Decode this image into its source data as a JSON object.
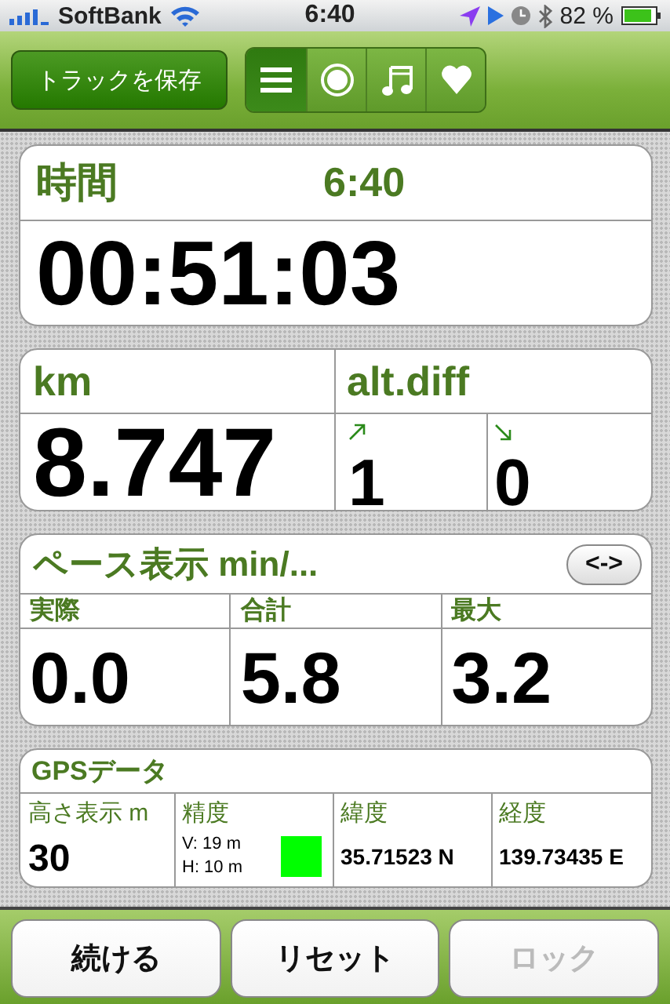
{
  "status_bar": {
    "carrier": "SoftBank",
    "time": "6:40",
    "battery": "82 %"
  },
  "toolbar": {
    "save_button": "トラックを保存",
    "segments": [
      {
        "kind": "list",
        "selected": true
      },
      {
        "kind": "record",
        "selected": false
      },
      {
        "kind": "music",
        "selected": false
      },
      {
        "kind": "heart",
        "selected": false
      }
    ]
  },
  "time_card": {
    "label": "時間",
    "clock": "6:40",
    "value": "00:51:03"
  },
  "distance_card": {
    "label": "km",
    "value": "8.747",
    "alt_label": "alt.diff",
    "ascent": "1",
    "descent": "0"
  },
  "pace_card": {
    "title": "ペース表示 min/...",
    "toggle": "<->",
    "cells": [
      {
        "label": "実際",
        "value": "0.0"
      },
      {
        "label": "合計",
        "value": "5.8"
      },
      {
        "label": "最大",
        "value": "3.2"
      }
    ]
  },
  "gps_card": {
    "title": "GPSデータ",
    "altitude": {
      "label": "高さ表示 m",
      "value": "30"
    },
    "accuracy": {
      "label": "精度",
      "vertical": "V: 19 m",
      "horizontal": "H: 10 m",
      "color": "#00ff00"
    },
    "latitude": {
      "label": "緯度",
      "value": "35.71523 N"
    },
    "longitude": {
      "label": "経度",
      "value": "139.73435 E"
    }
  },
  "buttons": [
    {
      "label": "続ける",
      "disabled": false
    },
    {
      "label": "リセット",
      "disabled": false
    },
    {
      "label": "ロック",
      "disabled": true
    }
  ]
}
